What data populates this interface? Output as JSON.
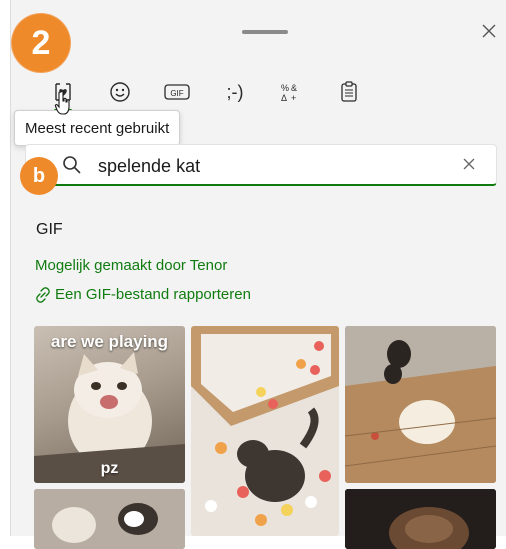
{
  "window": {
    "close_icon": "close-icon"
  },
  "step_badge": "2",
  "search_badge": "b",
  "tabs": [
    {
      "name": "recent-icon",
      "label": "Meest recent gebruikt",
      "active": true
    },
    {
      "name": "emoji-icon",
      "label": "Emoji"
    },
    {
      "name": "gif-icon",
      "label": "GIF"
    },
    {
      "name": "kaomoji-icon",
      "label": ";-)"
    },
    {
      "name": "symbols-icon",
      "label": "Symbolen"
    },
    {
      "name": "clipboard-icon",
      "label": "Klembord"
    }
  ],
  "tooltip": "Meest recent gebruikt",
  "search": {
    "value": "spelende kat",
    "clear_icon": "clear-icon"
  },
  "section": {
    "title": "GIF",
    "tenor_text": "Mogelijk gemaakt door Tenor",
    "report_text": "Een GIF-bestand rapporteren"
  },
  "gifs": [
    {
      "caption_top": "are we playing",
      "caption_bottom": "pz"
    },
    {
      "caption_top": "",
      "caption_bottom": ""
    },
    {
      "caption_top": "",
      "caption_bottom": ""
    },
    {
      "caption_top": "",
      "caption_bottom": ""
    },
    {
      "caption_top": "",
      "caption_bottom": ""
    },
    {
      "caption_top": "",
      "caption_bottom": ""
    }
  ],
  "colors": {
    "accent": "#0f7b0f",
    "link": "#107c10",
    "badge": "#ef8a2b"
  }
}
